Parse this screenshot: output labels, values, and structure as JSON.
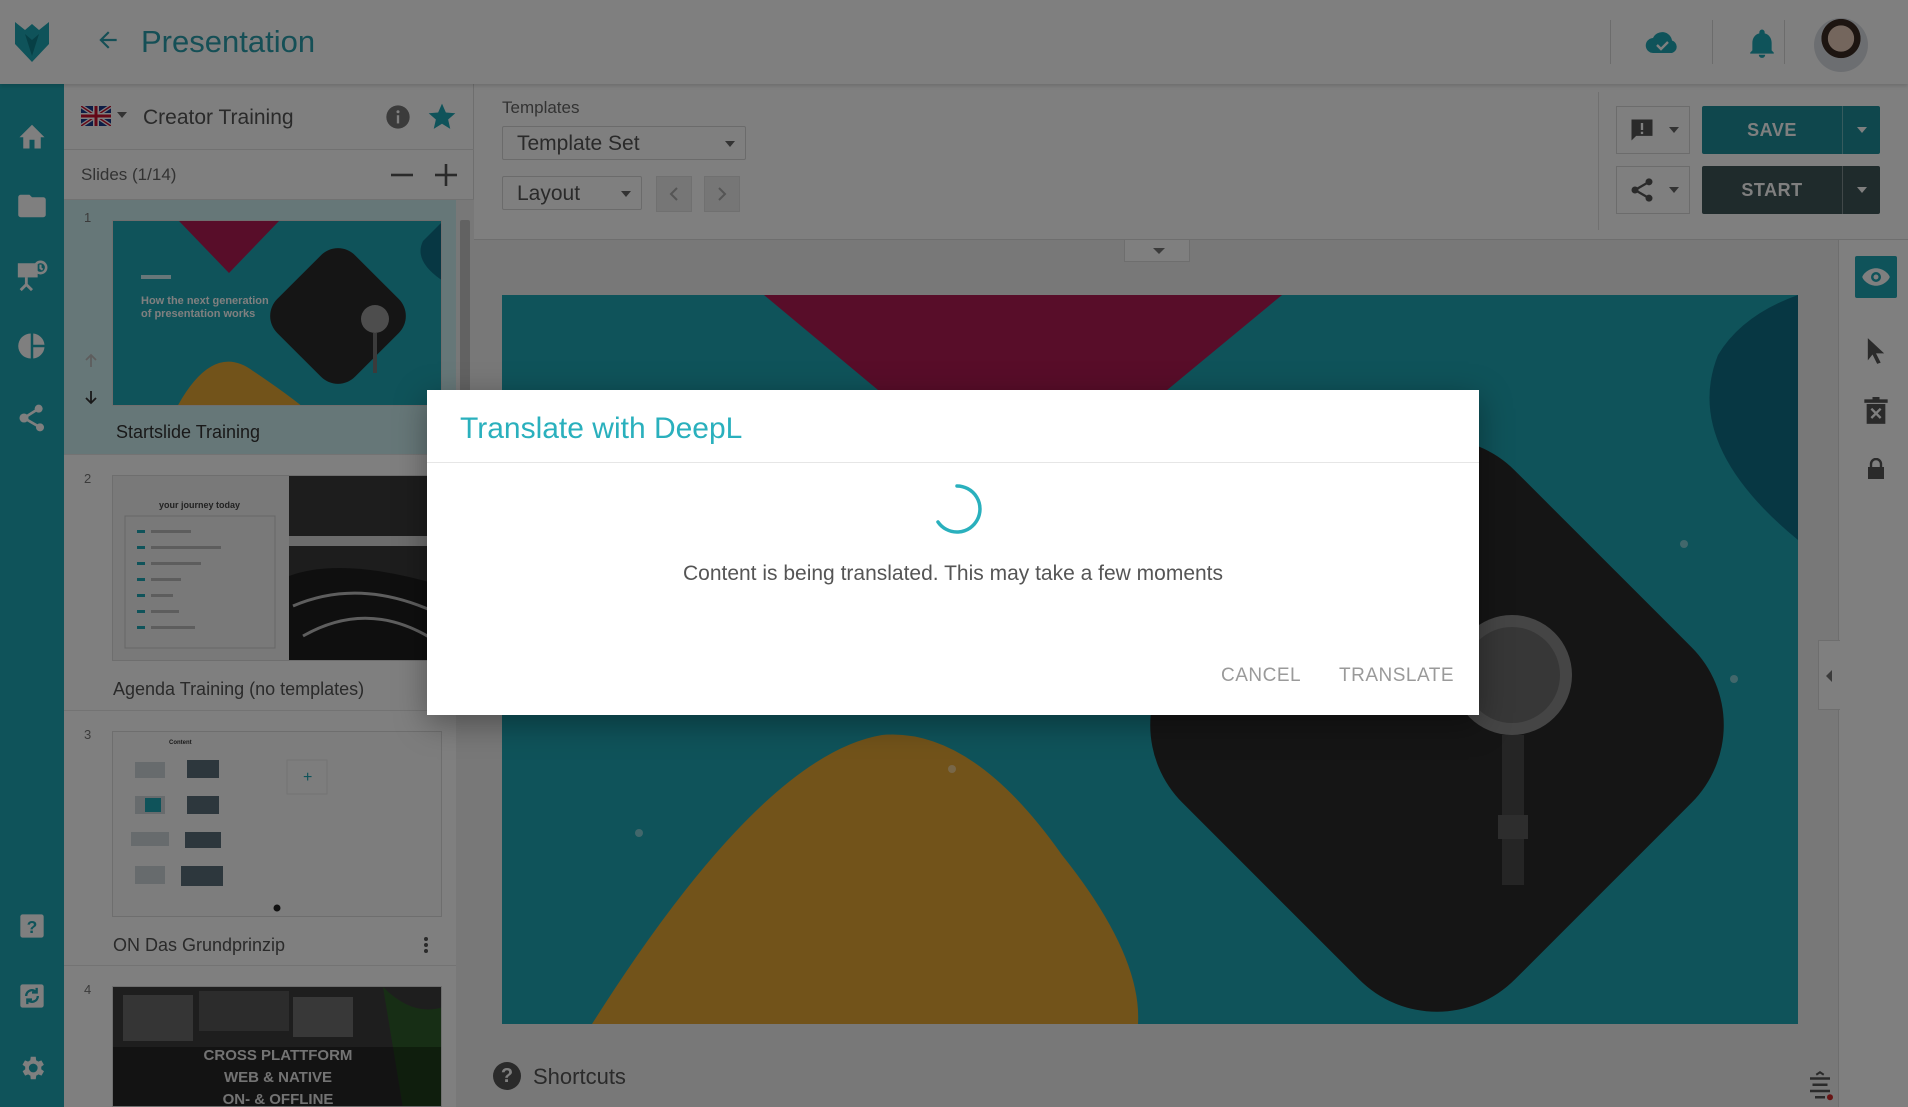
{
  "header": {
    "title": "Presentation"
  },
  "project": {
    "title": "Creator Training",
    "slides_count": "Slides (1/14)"
  },
  "slides": [
    {
      "num": "1",
      "label": "Startslide Training",
      "thumb_line1": "How the next generation",
      "thumb_line2": "of presentation works"
    },
    {
      "num": "2",
      "label": "Agenda Training (no templates)",
      "thumb_title": "your journey today"
    },
    {
      "num": "3",
      "label": "ON Das Grundprinzip",
      "thumb_title": "Content"
    },
    {
      "num": "4",
      "label": "",
      "thumb_line1": "CROSS PLATTFORM",
      "thumb_line2": "WEB & NATIVE",
      "thumb_line3": "ON- & OFFLINE"
    }
  ],
  "toolbar": {
    "templates_label": "Templates",
    "template_set": "Template Set",
    "layout": "Layout",
    "save_label": "SAVE",
    "start_label": "START"
  },
  "footer": {
    "shortcuts_label": "Shortcuts"
  },
  "dialog": {
    "title": "Translate with DeepL",
    "message": "Content is being translated. This may take a few moments",
    "cancel_label": "CANCEL",
    "translate_label": "TRANSLATE"
  },
  "colors": {
    "accent": "#1fa7b4",
    "dialog_title": "#2ab0bd",
    "save_button": "#1e8f9a",
    "start_button": "#3f5658",
    "stage_magenta": "#b01b52",
    "stage_yellow": "#e5a635",
    "stage_dark_teal": "#0e6f86"
  },
  "icons": {
    "logo": "fox-logo-icon",
    "back": "arrow-left-icon",
    "cloud": "cloud-done-icon",
    "notifications": "bell-icon",
    "info": "info-icon",
    "favorite": "star-icon",
    "comment": "comment-alert-icon",
    "share": "share-icon",
    "preview": "eye-icon",
    "select": "cursor-icon",
    "delete": "trash-icon",
    "lock": "lock-icon"
  }
}
